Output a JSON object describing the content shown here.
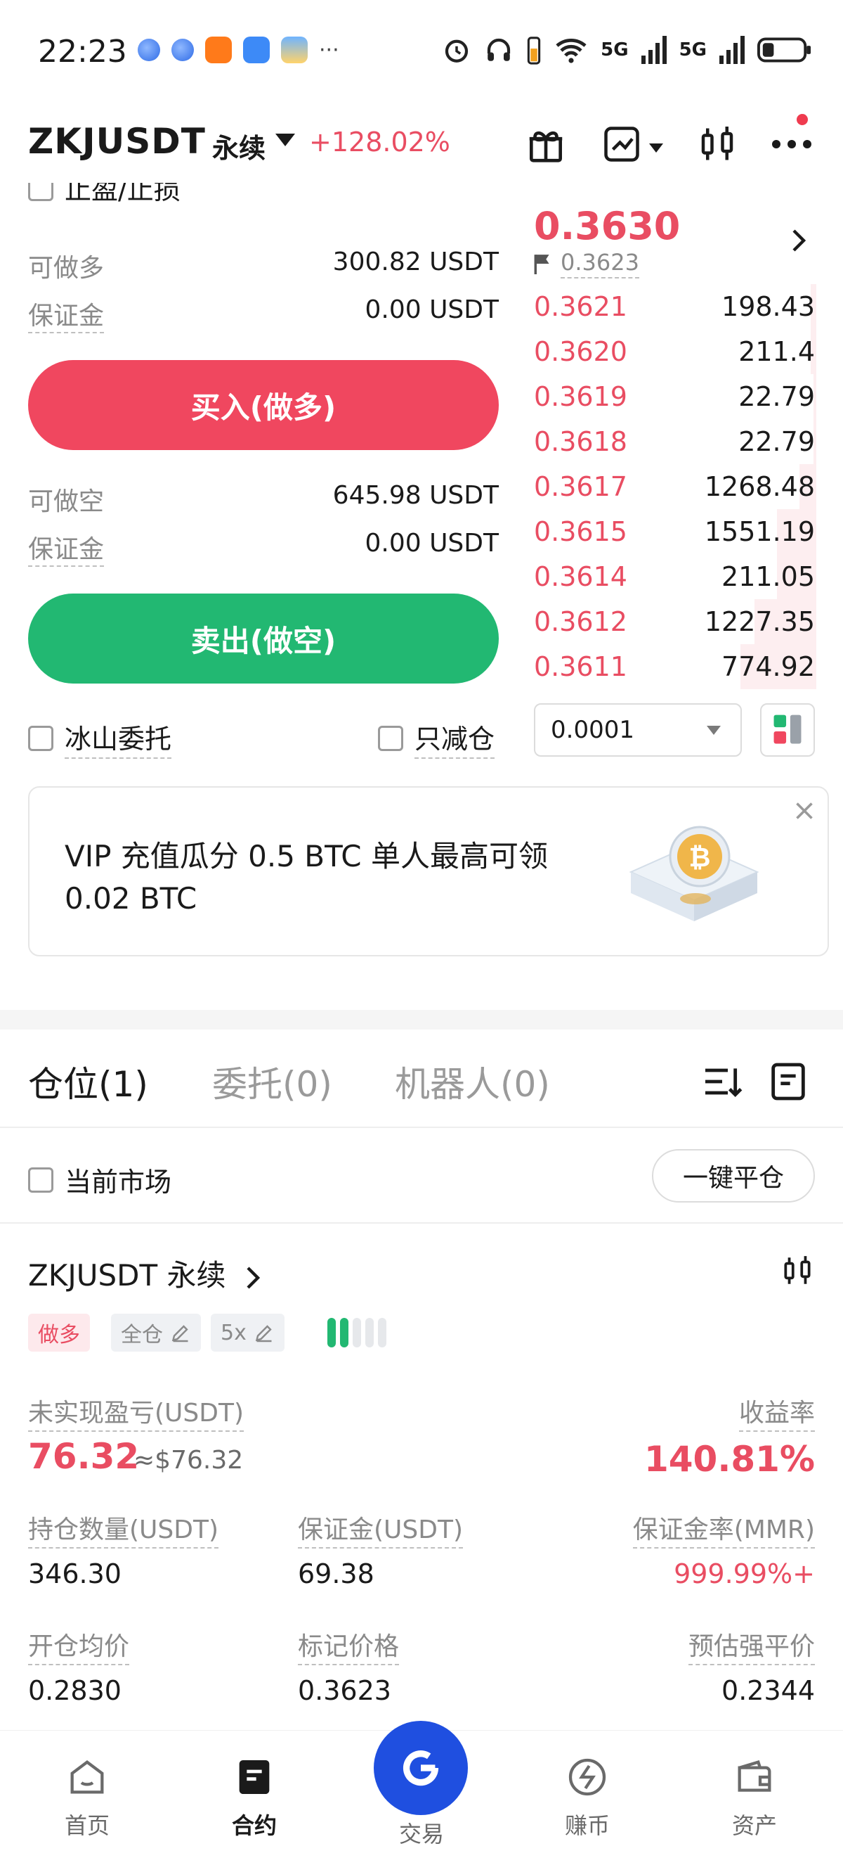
{
  "status_bar": {
    "time": "22:23",
    "network_1": "5G",
    "network_2": "5G"
  },
  "header": {
    "pair": "ZKJUSDT",
    "contract_type": "永续",
    "change": "+128.02%",
    "icons": [
      "gift-icon",
      "chart-trend-icon",
      "candlestick-icon",
      "more-icon"
    ]
  },
  "trade": {
    "tp_sl_label": "止盈/止损",
    "long_available_label": "可做多",
    "long_available_value": "300.82 USDT",
    "long_margin_label": "保证金",
    "long_margin_value": "0.00 USDT",
    "buy_label": "买入(做多)",
    "short_available_label": "可做空",
    "short_available_value": "645.98 USDT",
    "short_margin_label": "保证金",
    "short_margin_value": "0.00 USDT",
    "sell_label": "卖出(做空)",
    "iceberg_label": "冰山委托",
    "reduce_only_label": "只减仓"
  },
  "orderbook": {
    "last_price": "0.3630",
    "mark_price": "0.3623",
    "rows": [
      {
        "price": "0.3621",
        "qty": "198.43",
        "depth": 0.02
      },
      {
        "price": "0.3620",
        "qty": "211.4",
        "depth": 0.02
      },
      {
        "price": "0.3619",
        "qty": "22.79",
        "depth": 0.01
      },
      {
        "price": "0.3618",
        "qty": "22.79",
        "depth": 0.01
      },
      {
        "price": "0.3617",
        "qty": "1268.48",
        "depth": 0.06
      },
      {
        "price": "0.3615",
        "qty": "1551.19",
        "depth": 0.14
      },
      {
        "price": "0.3614",
        "qty": "211.05",
        "depth": 0.14
      },
      {
        "price": "0.3612",
        "qty": "1227.35",
        "depth": 0.22
      },
      {
        "price": "0.3611",
        "qty": "774.92",
        "depth": 0.27
      }
    ],
    "tick_size": "0.0001"
  },
  "banner": {
    "text": "VIP 充值瓜分 0.5 BTC 单人最高可领 0.02 BTC"
  },
  "tabs": {
    "positions": "仓位(1)",
    "orders": "委托(0)",
    "bots": "机器人(0)"
  },
  "filter": {
    "current_market": "当前市场",
    "close_all": "一键平仓"
  },
  "position": {
    "title": "ZKJUSDT 永续",
    "side": "做多",
    "margin_mode": "全仓",
    "leverage": "5x",
    "upnl_label": "未实现盈亏(USDT)",
    "upnl_value": "76.32",
    "upnl_usd": "≈$76.32",
    "roe_label": "收益率",
    "roe_value": "140.81%",
    "size_label": "持仓数量(USDT)",
    "size_value": "346.30",
    "margin_label": "保证金(USDT)",
    "margin_value": "69.38",
    "mmr_label": "保证金率(MMR)",
    "mmr_value": "999.99%+",
    "entry_label": "开仓均价",
    "entry_value": "0.2830",
    "mark_label": "标记价格",
    "mark_value": "0.3623",
    "liq_label": "预估强平价",
    "liq_value": "0.2344"
  },
  "nav": {
    "home": "首页",
    "futures": "合约",
    "trade": "交易",
    "earn": "赚币",
    "assets": "资产"
  },
  "colors": {
    "red": "#e94d62",
    "green": "#22b872",
    "blue": "#1f4fe0"
  }
}
